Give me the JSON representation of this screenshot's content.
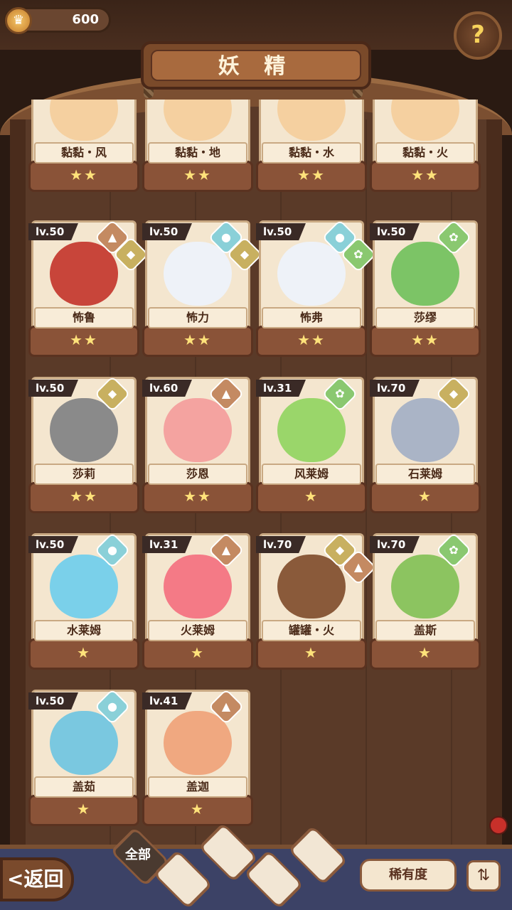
{
  "header": {
    "coin_value": "600",
    "title": "妖 精",
    "help_icon": "question-sprout-icon"
  },
  "cards": [
    {
      "name": "黏黏・风",
      "level": "",
      "stars": "★★",
      "elements": [],
      "portrait_color": "#f5d0a0"
    },
    {
      "name": "黏黏・地",
      "level": "",
      "stars": "★★",
      "elements": [],
      "portrait_color": "#f5d0a0"
    },
    {
      "name": "黏黏・水",
      "level": "",
      "stars": "★★",
      "elements": [],
      "portrait_color": "#f5d0a0"
    },
    {
      "name": "黏黏・火",
      "level": "",
      "stars": "★★",
      "elements": [],
      "portrait_color": "#f5d0a0"
    },
    {
      "name": "怖鲁",
      "level": "lv.50",
      "stars": "★★",
      "elements": [
        "fire",
        "earth"
      ],
      "portrait_color": "#c8453a"
    },
    {
      "name": "怖力",
      "level": "lv.50",
      "stars": "★★",
      "elements": [
        "water",
        "earth"
      ],
      "portrait_color": "#eef2f8"
    },
    {
      "name": "怖弗",
      "level": "lv.50",
      "stars": "★★",
      "elements": [
        "water",
        "wind"
      ],
      "portrait_color": "#eef2f8"
    },
    {
      "name": "莎缪",
      "level": "lv.50",
      "stars": "★★",
      "elements": [
        "wind"
      ],
      "portrait_color": "#7cc466"
    },
    {
      "name": "莎莉",
      "level": "lv.50",
      "stars": "★★",
      "elements": [
        "earth"
      ],
      "portrait_color": "#8a8a8a"
    },
    {
      "name": "莎恩",
      "level": "lv.60",
      "stars": "★★",
      "elements": [
        "fire"
      ],
      "portrait_color": "#f4a3a0"
    },
    {
      "name": "风莱姆",
      "level": "lv.31",
      "stars": "★",
      "elements": [
        "wind"
      ],
      "portrait_color": "#9ad66a"
    },
    {
      "name": "石莱姆",
      "level": "lv.70",
      "stars": "★",
      "elements": [
        "earth"
      ],
      "portrait_color": "#aab4c6"
    },
    {
      "name": "水莱姆",
      "level": "lv.50",
      "stars": "★",
      "elements": [
        "water"
      ],
      "portrait_color": "#7ad0ea"
    },
    {
      "name": "火莱姆",
      "level": "lv.31",
      "stars": "★",
      "elements": [
        "fire"
      ],
      "portrait_color": "#f47a86"
    },
    {
      "name": "罐罐・火",
      "level": "lv.70",
      "stars": "★",
      "elements": [
        "earth",
        "fire"
      ],
      "portrait_color": "#8a5a3a"
    },
    {
      "name": "盖斯",
      "level": "lv.70",
      "stars": "★",
      "elements": [
        "wind"
      ],
      "portrait_color": "#8cc460"
    },
    {
      "name": "盖茹",
      "level": "lv.50",
      "stars": "★",
      "elements": [
        "water"
      ],
      "portrait_color": "#7ac8e0"
    },
    {
      "name": "盖迦",
      "level": "lv.41",
      "stars": "★",
      "elements": [
        "fire"
      ],
      "portrait_color": "#f0a880"
    }
  ],
  "element_colors": {
    "fire": "#c48a62",
    "earth": "#c8b060",
    "water": "#8ad0d8",
    "wind": "#8ac870"
  },
  "element_icons": {
    "fire": "▲",
    "earth": "◆",
    "water": "●",
    "wind": "✿"
  },
  "bottom": {
    "back_label": "<返回",
    "filter_all_label": "全部",
    "rarity_label": "稀有度",
    "sort_icon": "sort-icon"
  }
}
